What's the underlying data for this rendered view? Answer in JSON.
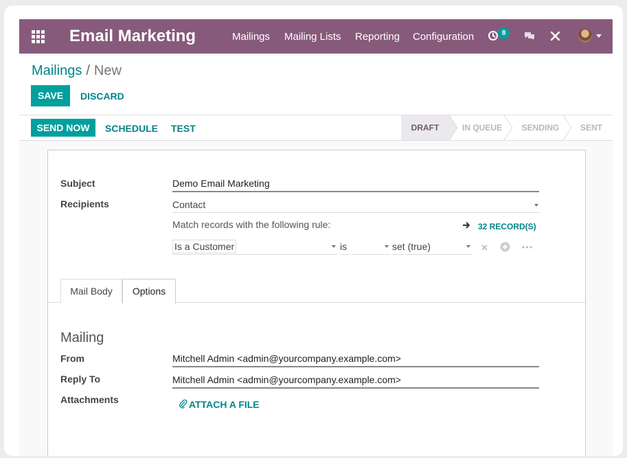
{
  "navbar": {
    "app_name": "Email Marketing",
    "menu": [
      "Mailings",
      "Mailing Lists",
      "Reporting",
      "Configuration"
    ],
    "activity_count": "8",
    "icons": [
      "apps-icon",
      "clock-icon",
      "chat-icon",
      "tools-icon",
      "avatar",
      "caret-down-icon"
    ],
    "color": "#875a7b"
  },
  "breadcrumb": {
    "parent": "Mailings",
    "separator": "/",
    "current": "New"
  },
  "form_buttons": {
    "save": "SAVE",
    "discard": "DISCARD"
  },
  "actions": {
    "send_now": "SEND NOW",
    "schedule": "SCHEDULE",
    "test": "TEST"
  },
  "stages": [
    "DRAFT",
    "IN QUEUE",
    "SENDING",
    "SENT"
  ],
  "active_stage": "DRAFT",
  "form": {
    "subject_label": "Subject",
    "subject_value": "Demo Email Marketing",
    "recipients_label": "Recipients",
    "recipients_value": "Contact",
    "rule_text": "Match records with the following rule:",
    "records_link": "32 RECORD(S)",
    "rule": {
      "field": "Is a Customer",
      "operator": "is",
      "value": "set (true)"
    }
  },
  "tabs": [
    "Mail Body",
    "Options"
  ],
  "active_tab": "Options",
  "mailing": {
    "title": "Mailing",
    "from_label": "From",
    "from_value": "Mitchell Admin <admin@yourcompany.example.com>",
    "reply_label": "Reply To",
    "reply_value": "Mitchell Admin <admin@yourcompany.example.com>",
    "attach_label": "Attachments",
    "attach_button": "ATTACH A FILE"
  },
  "colors": {
    "accent": "#00a09d",
    "link": "#00858a"
  }
}
